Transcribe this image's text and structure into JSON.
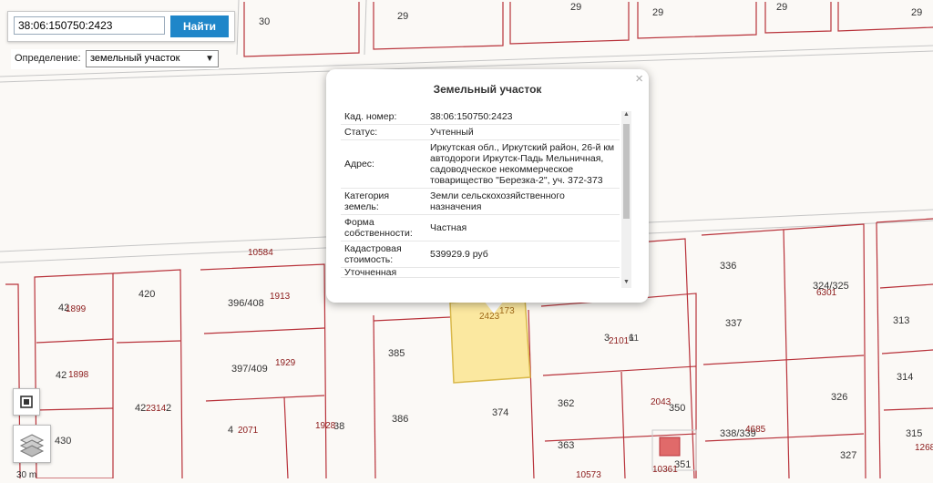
{
  "search": {
    "value": "38:06:150750:2423",
    "button_label": "Найти"
  },
  "definition": {
    "label": "Определение:",
    "selected": "земельный участок"
  },
  "popup": {
    "title": "Земельный участок",
    "close_symbol": "×",
    "rows": [
      {
        "key": "Кад. номер:",
        "value": "38:06:150750:2423"
      },
      {
        "key": "Статус:",
        "value": "Учтенный"
      },
      {
        "key": "Адрес:",
        "value": "Иркутская обл., Иркутский район, 26-й км автодороги Иркутск-Падь Мельничная, садоводческое некоммерческое товарищество \"Березка-2\", уч. 372-373"
      },
      {
        "key": "Категория земель:",
        "value": "Земли сельскохозяйственного назначения"
      },
      {
        "key": "Форма собственности:",
        "value": "Частная"
      },
      {
        "key": "Кадастровая стоимость:",
        "value": "539929.9 руб"
      },
      {
        "key": "Уточненная",
        "value": ""
      }
    ]
  },
  "map": {
    "parcel_labels": [
      "30",
      "29",
      "29",
      "29",
      "29",
      "29",
      "420",
      "396/408",
      "385",
      "397/409",
      "386",
      "374",
      "430",
      "336",
      "337",
      "324/325",
      "313",
      "314",
      "326",
      "327",
      "315",
      "338/339",
      "362",
      "350",
      "363",
      "351",
      "3",
      "1",
      "4",
      "38",
      "42",
      "42",
      "42",
      "2"
    ],
    "cadastral_numbers": [
      "10584",
      "1899",
      "1898",
      "2314",
      "1913",
      "1929",
      "2071",
      "1928",
      "2101",
      "2043",
      "4685",
      "6301",
      "10573",
      "10361",
      "1268",
      "2423",
      "173",
      "61"
    ],
    "scale_label": "30 m"
  },
  "controls": {
    "frame_icon": "frame-select-icon",
    "layers_icon": "layers-icon"
  },
  "colors": {
    "parcel_border": "#b8323a",
    "road_line": "#c4c4c4",
    "selected_fill": "#fbe8a0",
    "selected_stroke": "#d9b84a",
    "button_blue": "#1f86c9",
    "building_fill": "#e06a6a"
  }
}
